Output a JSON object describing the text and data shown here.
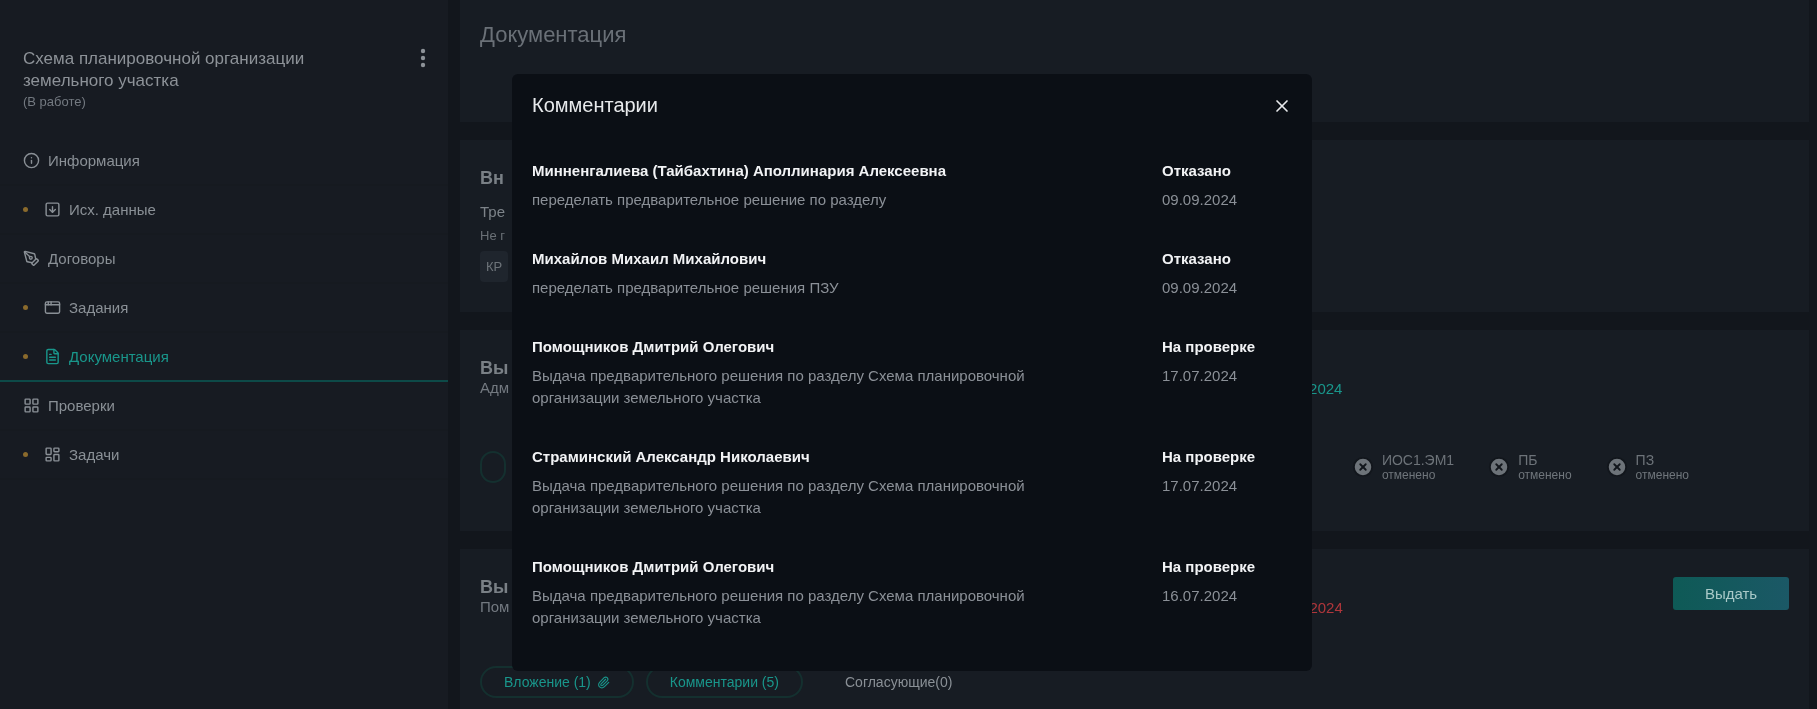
{
  "sidebar": {
    "title": "Схема планировочной организации земельного участка",
    "status": "(В работе)",
    "items": [
      {
        "label": "Информация",
        "marked": false,
        "selected": false
      },
      {
        "label": "Исх. данные",
        "marked": true,
        "selected": false
      },
      {
        "label": "Договоры",
        "marked": false,
        "selected": false
      },
      {
        "label": "Задания",
        "marked": true,
        "selected": false
      },
      {
        "label": "Документация",
        "marked": true,
        "selected": true
      },
      {
        "label": "Проверки",
        "marked": false,
        "selected": false
      },
      {
        "label": "Задачи",
        "marked": true,
        "selected": false
      }
    ]
  },
  "main": {
    "title": "Документация",
    "cards": [
      {
        "kind": "request",
        "heading": "Вн",
        "label": "Тре",
        "note": "Не г",
        "chip": "КР"
      },
      {
        "kind": "issue",
        "heading": "Вы",
        "subtitle": "Адм",
        "date": "2024",
        "overdue": false,
        "sections": [
          {
            "code": "ИОС1.ЭМ1",
            "status": "отменено"
          },
          {
            "code": "ПБ",
            "status": "отменено"
          },
          {
            "code": "ПЗ",
            "status": "отменено"
          }
        ]
      },
      {
        "kind": "issue",
        "heading": "Вы",
        "subtitle": "Пом",
        "date": "2024",
        "overdue": true,
        "action": "Выдать",
        "pills": [
          "Вложение (1)",
          "Комментарии (5)"
        ],
        "approvers": "Согласующие(0)"
      }
    ]
  },
  "modal": {
    "title": "Комментарии",
    "comments": [
      {
        "author": "Минненгалиева (Тайбахтина) Аполлинария Алексеевна",
        "text": "переделать предварительное решение по разделу",
        "status": "Отказано",
        "date": "09.09.2024"
      },
      {
        "author": "Михайлов Михаил Михайлович",
        "text": "переделать предварительное решения ПЗУ",
        "status": "Отказано",
        "date": "09.09.2024"
      },
      {
        "author": "Помощников Дмитрий Олегович",
        "text": "Выдача предварительного решения по разделу Схема планировочной организации земельного участка",
        "status": "На проверке",
        "date": "17.07.2024"
      },
      {
        "author": "Страминский Александр Николаевич",
        "text": "Выдача предварительного решения по разделу Схема планировочной организации земельного участка",
        "status": "На проверке",
        "date": "17.07.2024"
      },
      {
        "author": "Помощников Дмитрий Олегович",
        "text": "Выдача предварительного решения по разделу Схема планировочной организации земельного участка",
        "status": "На проверке",
        "date": "16.07.2024"
      }
    ]
  }
}
